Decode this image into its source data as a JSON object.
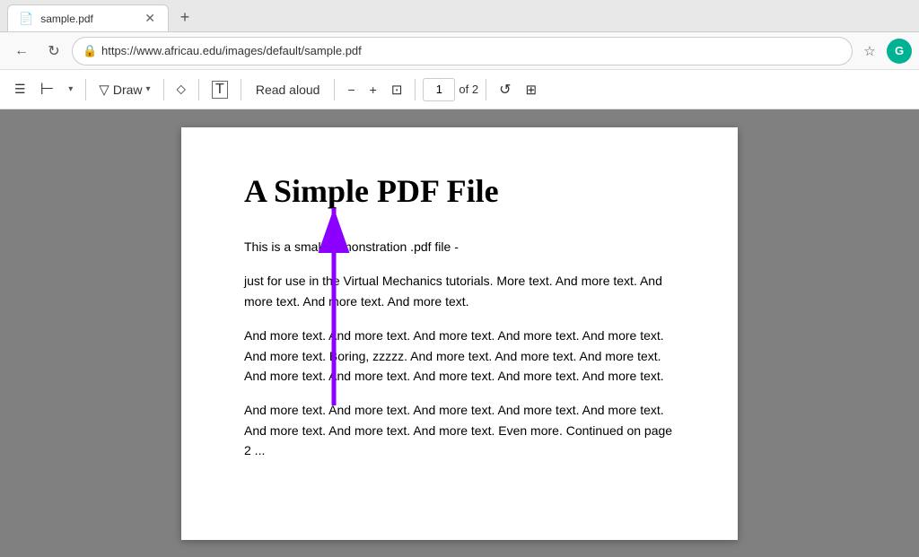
{
  "browser": {
    "tab_title": "sample.pdf",
    "tab_favicon": "📄",
    "close_btn": "✕",
    "new_tab_btn": "+",
    "back_btn": "←",
    "refresh_btn": "↻",
    "address_url": "https://www.africau.edu/images/default/sample.pdf",
    "fav_icon": "☆",
    "profile_letter": "G",
    "profile_color": "#00b294"
  },
  "toolbar": {
    "menu_icon": "☰",
    "bookmark_icon": "⊢",
    "draw_label": "Draw",
    "erase_icon": "◇",
    "text_icon": "⊤",
    "read_aloud_label": "Read aloud",
    "zoom_out": "−",
    "zoom_in": "+",
    "fit_icon": "⊡",
    "page_current": "1",
    "page_of": "of 2",
    "rotate_icon": "↺",
    "split_icon": "⊞"
  },
  "pdf": {
    "title": "A Simple PDF File",
    "paragraphs": [
      "This is a small demonstration .pdf file -",
      "just for use in the Virtual Mechanics tutorials. More text. And more text. And more text. And more text. And more text.",
      "And more text. And more text. And more text. And more text. And more text. And more text. Boring, zzzzz. And more text. And more text. And more text. And more text. And more text. And more text. And more text. And more text.",
      "And more text. And more text. And more text. And more text. And more text. And more text. And more text. And more text. Even more. Continued on page 2 ..."
    ]
  }
}
